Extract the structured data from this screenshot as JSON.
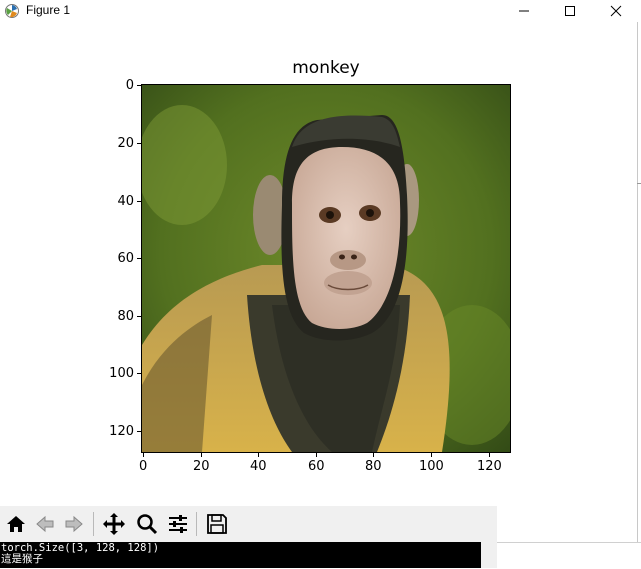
{
  "window": {
    "title": "Figure 1"
  },
  "plot": {
    "title": "monkey",
    "y_ticks": [
      "0",
      "20",
      "40",
      "60",
      "80",
      "100",
      "120"
    ],
    "x_ticks": [
      "0",
      "20",
      "40",
      "60",
      "80",
      "100",
      "120"
    ]
  },
  "toolbar": {
    "icons": [
      "home-icon",
      "back-icon",
      "forward-icon",
      "pan-icon",
      "zoom-icon",
      "configure-subplots-icon",
      "save-icon"
    ]
  },
  "console": {
    "line1": "torch.Size([3, 128, 128])",
    "line2": "這是猴子"
  }
}
